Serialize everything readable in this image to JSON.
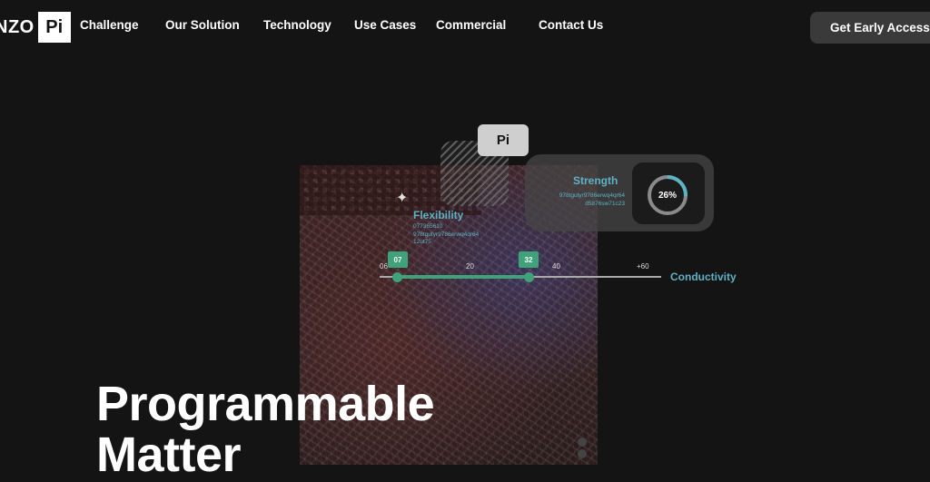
{
  "brand": {
    "logo_text": "NZO",
    "logo_mark": "Pi"
  },
  "nav": {
    "items": [
      {
        "label": "Challenge"
      },
      {
        "label": "Our Solution"
      },
      {
        "label": "Technology"
      },
      {
        "label": "Use Cases"
      },
      {
        "label": "Commercial"
      },
      {
        "label": "Contact Us"
      }
    ],
    "cta_label": "Get Early Access"
  },
  "hero": {
    "title_line1": "Programmable",
    "title_line2": "Matter",
    "pi_tag": "Pi",
    "sparkle_icon": "sparkle-icon",
    "flexibility": {
      "title": "Flexibility",
      "code_line1": "077365610",
      "code_line2": "978tgutyr9786erwq4qr64",
      "code_line3": "12ut75"
    },
    "strength": {
      "title": "Strength",
      "code_line1": "978tgutyr9786erwq4qr64",
      "code_line2": "d5876sw71c23",
      "gauge_value": "26%",
      "gauge_fraction": 0.26
    },
    "conductivity": {
      "label": "Conductivity",
      "ticks": [
        "06",
        "20",
        "40",
        "+60"
      ],
      "marker_low": "07",
      "marker_high": "32"
    }
  },
  "colors": {
    "background": "#141414",
    "accent_teal": "#5fb2c4",
    "accent_green": "#3fa27a",
    "cta_bg": "#3a3a3a"
  }
}
